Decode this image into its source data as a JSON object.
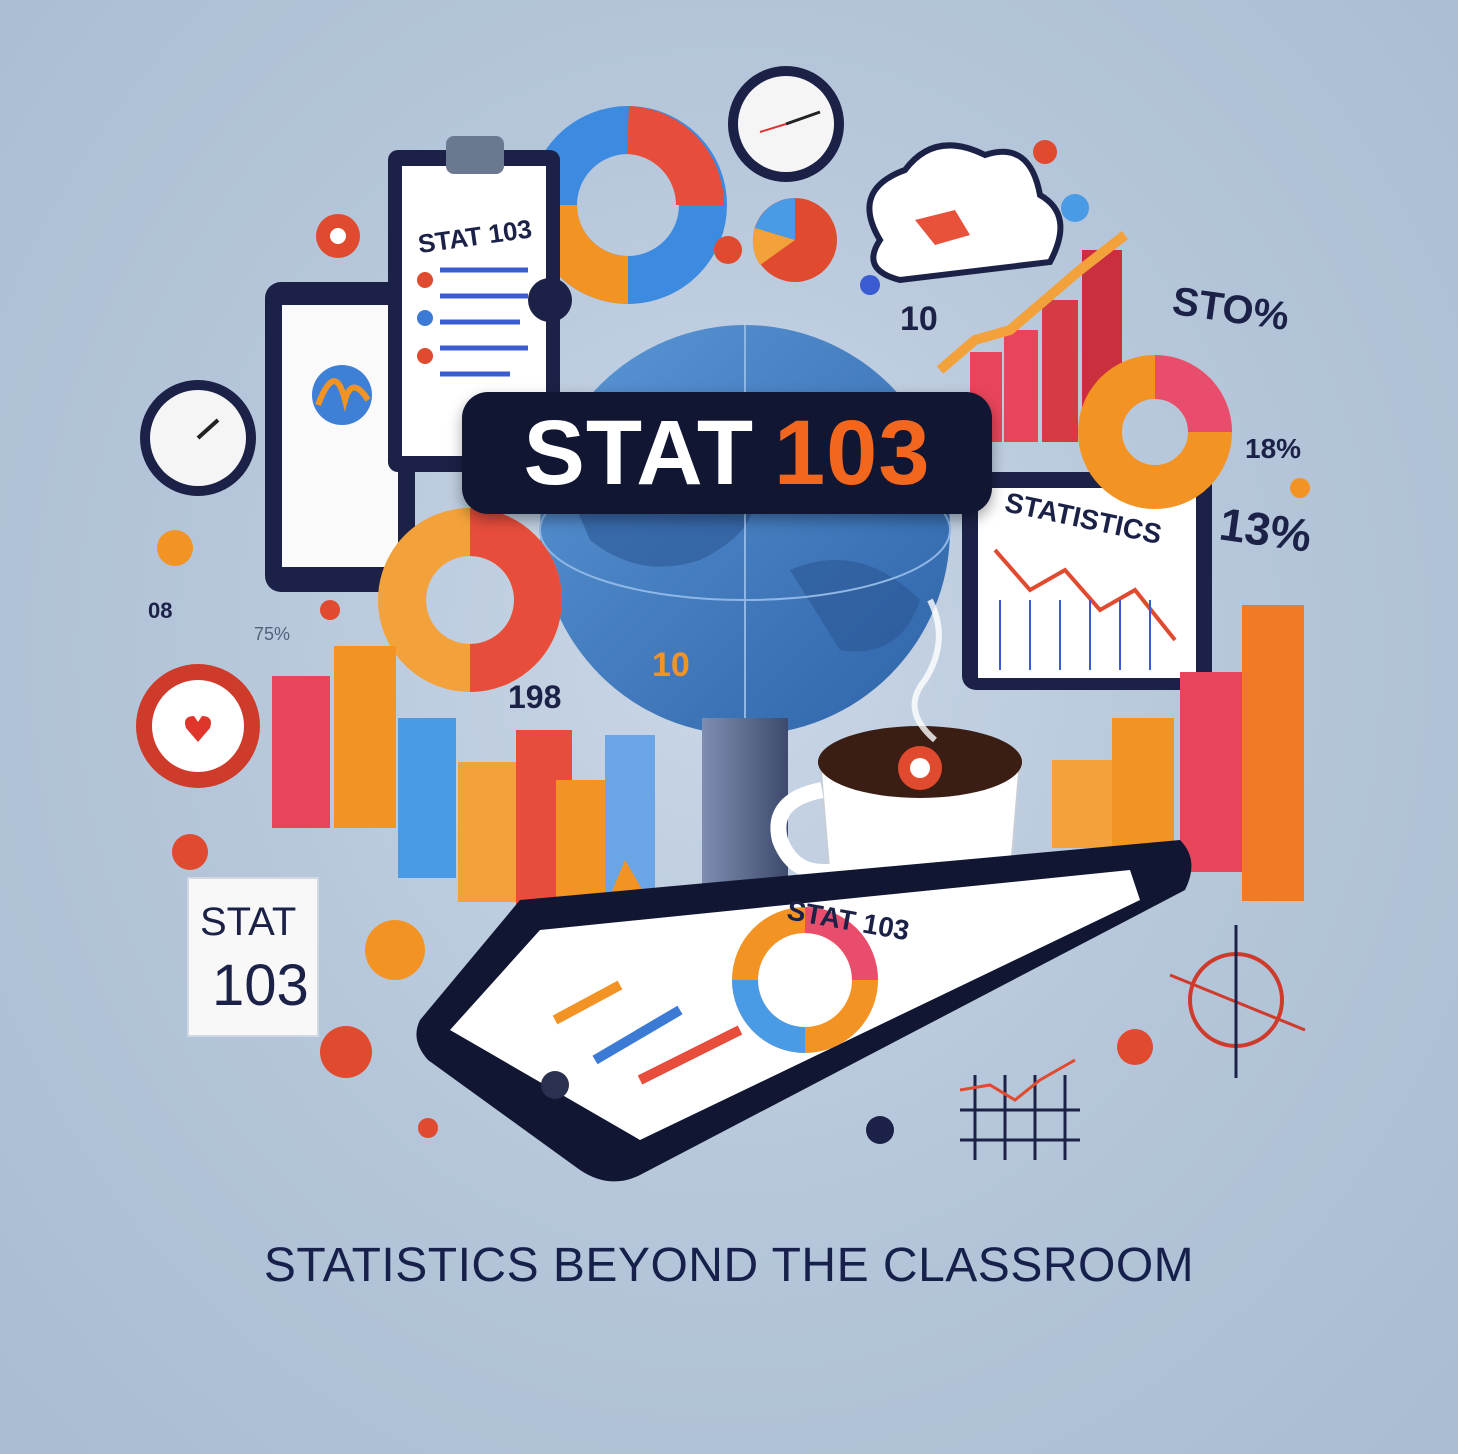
{
  "title": {
    "prefix": "STAT",
    "number": "103"
  },
  "tagline": "STATISTICS BEYOND THE CLASSROOM",
  "labels": {
    "clipboard": "STAT 103",
    "laptop": "STATISTICS",
    "phone": "STAT 103",
    "card_line1": "STAT",
    "card_line2": "103",
    "pct_top": "STO%",
    "pct_mid": "18%",
    "pct_right": "13%",
    "num_10_top": "10",
    "num_10_globe": "10",
    "num_198": "198",
    "num_08": "08",
    "num_75": "75%"
  },
  "colors": {
    "title_box": "#111633",
    "title_number": "#f2661d",
    "tagline": "#16204a"
  }
}
